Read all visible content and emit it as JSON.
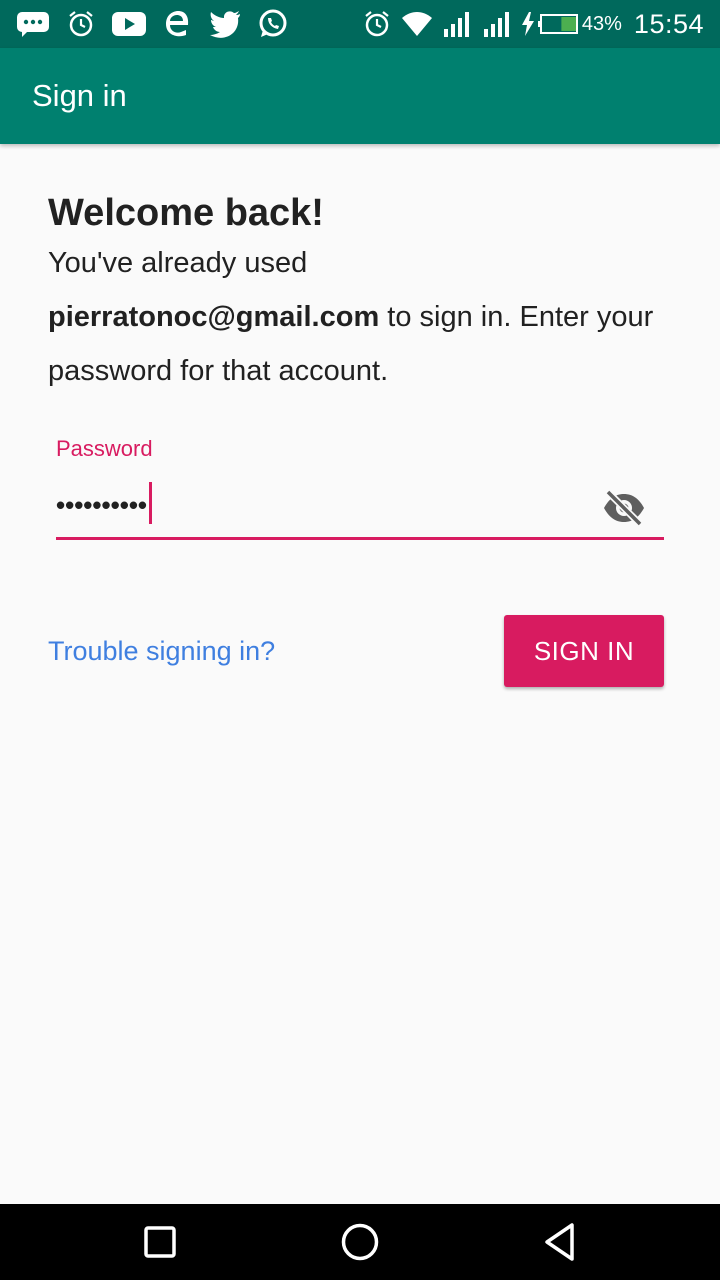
{
  "status_bar": {
    "left_icons": [
      "messages-icon",
      "alarm-icon",
      "youtube-icon",
      "browser-icon",
      "twitter-icon",
      "whatsapp-icon"
    ],
    "right_icons": [
      "alarm-icon",
      "wifi-icon",
      "signal-icon",
      "signal-icon",
      "charging-icon",
      "battery-icon"
    ],
    "battery": "43%",
    "battery_level": 0.43,
    "time": "15:54"
  },
  "app_bar": {
    "title": "Sign in",
    "background": "#00806f"
  },
  "welcome": {
    "title": "Welcome back!",
    "line_prefix": "You've already used",
    "email": "pierratonoc@gmail.com",
    "line_suffix": " to sign in. Enter your password for that account."
  },
  "password": {
    "label": "Password",
    "value_masked": "••••••••••",
    "toggle_icon": "visibility-off-icon",
    "accent": "#d81b60"
  },
  "actions": {
    "trouble_link": "Trouble signing in?",
    "sign_in_label": "SIGN IN",
    "link_color": "#3f7fe0"
  },
  "nav_bar": {
    "buttons": [
      "recents-icon",
      "home-icon",
      "back-icon"
    ]
  }
}
